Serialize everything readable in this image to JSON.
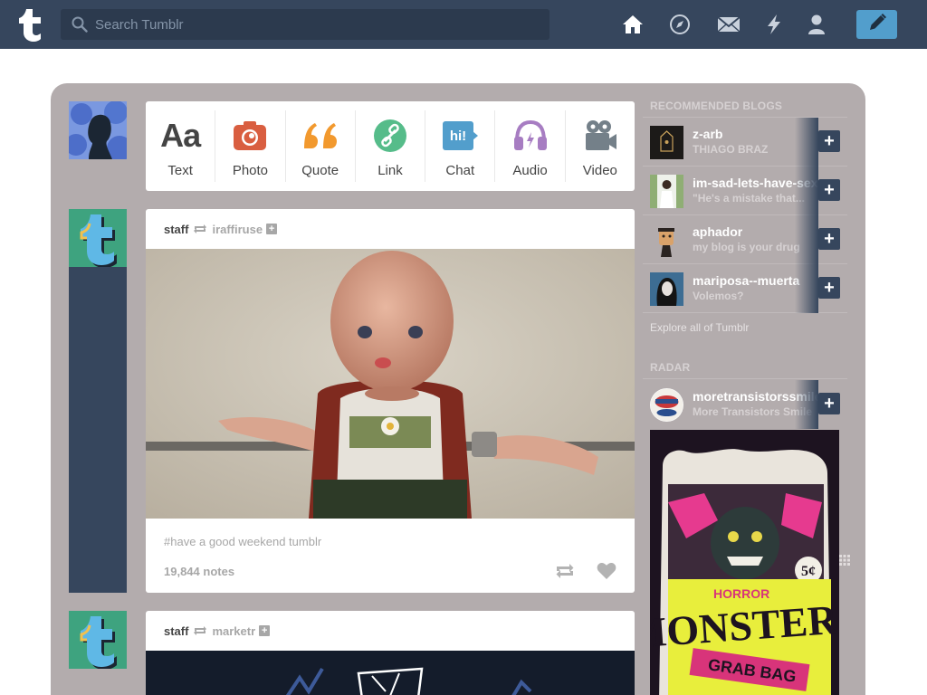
{
  "header": {
    "search_placeholder": "Search Tumblr",
    "nav": [
      "home-icon",
      "explore-icon",
      "inbox-icon",
      "activity-icon",
      "account-icon"
    ],
    "accent_color": "#529ecc",
    "bar_color": "#36465d"
  },
  "composer": {
    "types": [
      {
        "label": "Text",
        "icon": "text-icon",
        "color": "#444444"
      },
      {
        "label": "Photo",
        "icon": "camera-icon",
        "color": "#d95e40"
      },
      {
        "label": "Quote",
        "icon": "quote-icon",
        "color": "#f2992e"
      },
      {
        "label": "Link",
        "icon": "link-icon",
        "color": "#56bc8a"
      },
      {
        "label": "Chat",
        "icon": "chat-icon",
        "color": "#529ecc"
      },
      {
        "label": "Audio",
        "icon": "headphones-icon",
        "color": "#a77dc2"
      },
      {
        "label": "Video",
        "icon": "video-icon",
        "color": "#748089"
      }
    ]
  },
  "posts": [
    {
      "author": "staff",
      "source": "iraffiruse",
      "tags": "#have a good weekend tumblr",
      "notes": "19,844 notes"
    },
    {
      "author": "staff",
      "source": "marketr"
    }
  ],
  "sidebar": {
    "recommended_title": "RECOMMENDED BLOGS",
    "blogs": [
      {
        "name": "z-arb",
        "subtitle": "THIAGO BRAZ"
      },
      {
        "name": "im-sad-lets-have-sex",
        "subtitle": "\"He's a mistake that..."
      },
      {
        "name": "aphador",
        "subtitle": "my blog is your drug"
      },
      {
        "name": "mariposa--muerta",
        "subtitle": "Volemos?"
      }
    ],
    "explore_link": "Explore all of Tumblr",
    "radar_title": "RADAR",
    "radar": {
      "name": "moretransistorssmile",
      "subtitle": "More Transistors Smile"
    }
  }
}
